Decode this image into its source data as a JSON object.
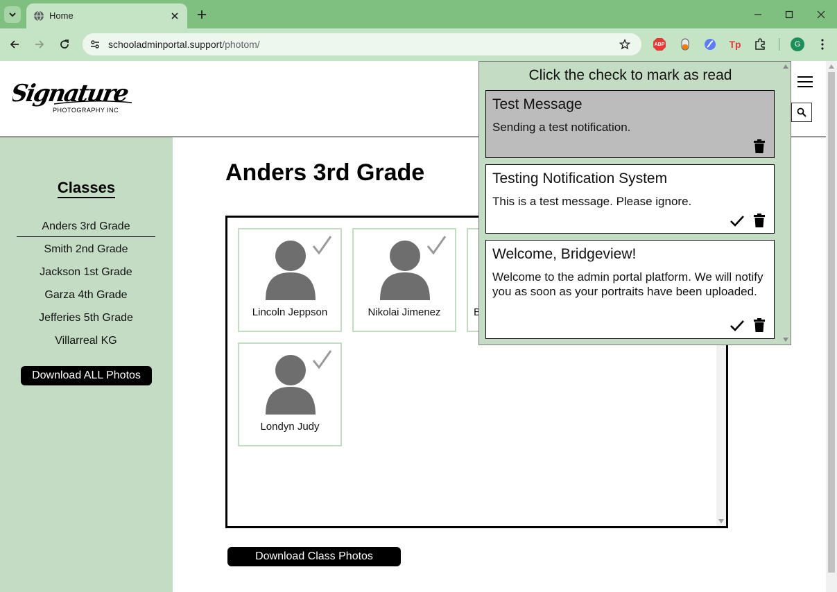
{
  "browser": {
    "tab_title": "Home",
    "url_domain": "schooladminportal.support",
    "url_path": "/photom/",
    "profile_initial": "G",
    "ext_abp": "ABP",
    "ext_tp": "Tp"
  },
  "header": {
    "logo_text": "Signature",
    "logo_subtext": "PHOTOGRAPHY INC"
  },
  "sidebar": {
    "title": "Classes",
    "classes": [
      {
        "label": "Anders 3rd Grade"
      },
      {
        "label": "Smith 2nd Grade"
      },
      {
        "label": "Jackson 1st Grade"
      },
      {
        "label": "Garza 4th Grade"
      },
      {
        "label": "Jefferies 5th Grade"
      },
      {
        "label": "Villarreal KG"
      }
    ],
    "download_all_label": "Download ALL Photos"
  },
  "main": {
    "title": "Anders 3rd Grade",
    "students": [
      {
        "name": "Lincoln Jeppson"
      },
      {
        "name": "Nikolai Jimenez"
      },
      {
        "name": "B"
      },
      {
        "name": "Londyn Judy"
      }
    ],
    "download_class_label": "Download Class Photos"
  },
  "notifications": {
    "header": "Click the check to mark as read",
    "items": [
      {
        "title": "Test Message",
        "body": "Sending a test notification.",
        "read": true
      },
      {
        "title": "Testing Notification System",
        "body": "This is a test message. Please ignore.",
        "read": false
      },
      {
        "title": "Welcome, Bridgeview!",
        "body": "Welcome to the admin portal platform. We will notify you as soon as your portraits have been uploaded.",
        "read": false
      }
    ]
  },
  "colors": {
    "chrome_green": "#7fbf7f",
    "toolbar_green": "#c5e3c5",
    "sidebar_green": "#c3dcc3",
    "avatar_gray": "#6e6e6e",
    "check_gray": "#9a9a9a"
  }
}
